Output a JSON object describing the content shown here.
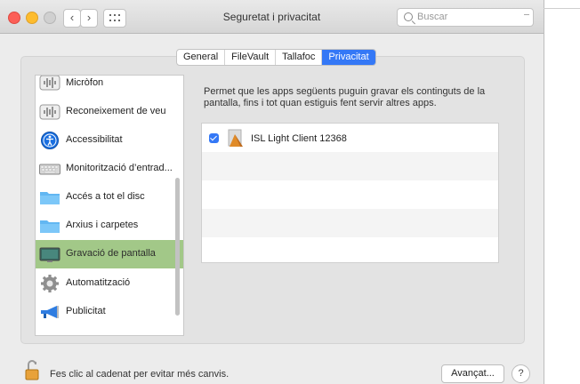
{
  "window": {
    "title": "Seguretat i privacitat",
    "search_placeholder": "Buscar",
    "nav_back": "‹",
    "nav_forward": "›",
    "grid_icon": "grid-icon"
  },
  "tabs": [
    {
      "label": "General",
      "active": false
    },
    {
      "label": "FileVault",
      "active": false
    },
    {
      "label": "Tallafoc",
      "active": false
    },
    {
      "label": "Privacitat",
      "active": true
    }
  ],
  "sidebar": {
    "items": [
      {
        "label": "Micròfon",
        "icon": "microphone-waveform-icon"
      },
      {
        "label": "Reconeixement de veu",
        "icon": "speech-waveform-icon"
      },
      {
        "label": "Accessibilitat",
        "icon": "accessibility-icon"
      },
      {
        "label": "Monitorització d’entrad...",
        "icon": "keyboard-icon"
      },
      {
        "label": "Accés a tot el disc",
        "icon": "folder-icon"
      },
      {
        "label": "Arxius i carpetes",
        "icon": "folder-icon"
      },
      {
        "label": "Gravació de pantalla",
        "icon": "display-icon",
        "selected": true
      },
      {
        "label": "Automatització",
        "icon": "gear-icon"
      },
      {
        "label": "Publicitat",
        "icon": "megaphone-icon"
      }
    ]
  },
  "main": {
    "description": "Permet que les apps següents puguin gravar els continguts de la pantalla, fins i tot quan estiguis fent servir altres apps.",
    "apps": [
      {
        "name": "ISL Light Client 12368",
        "checked": true,
        "icon": "isl-app-icon"
      }
    ]
  },
  "footer": {
    "lock_text": "Fes clic al cadenat per evitar més canvis.",
    "advanced_label": "Avançat...",
    "help_label": "?"
  },
  "colors": {
    "accent": "#3478f6",
    "selection": "#9ec682",
    "close": "#fc5f57",
    "minimize": "#fdbc2e",
    "zoom_inactive": "#d0d0d0"
  }
}
